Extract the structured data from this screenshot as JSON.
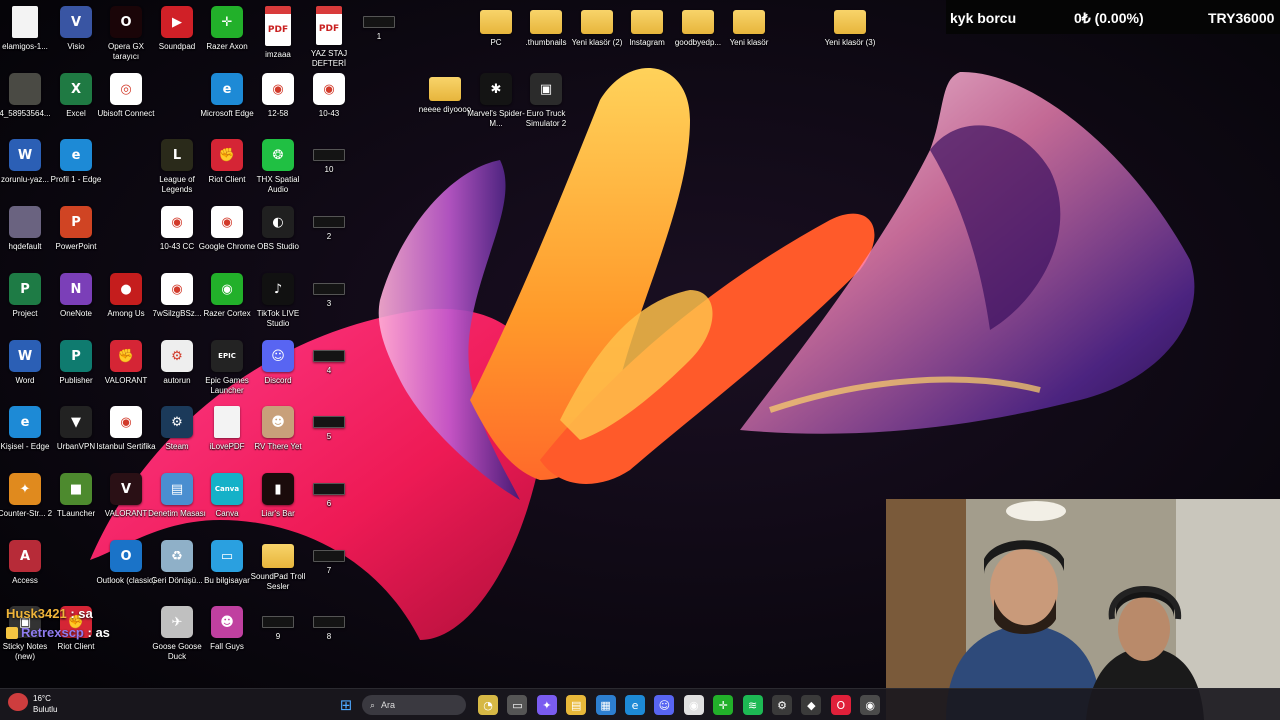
{
  "desktop_icons": [
    {
      "label": "elamigos-1...",
      "icon": "file-icon",
      "color": "#f3f3f3",
      "kind": "doc",
      "glyph": ""
    },
    {
      "label": "Visio",
      "icon": "visio-icon",
      "color": "#3955a3",
      "glyph": "V"
    },
    {
      "label": "Opera GX tarayıcı",
      "icon": "opera-gx-icon",
      "color": "#1a0508",
      "glyph": "O"
    },
    {
      "label": "Soundpad",
      "icon": "soundpad-icon",
      "color": "#d02027",
      "glyph": "▶"
    },
    {
      "label": "Razer Axon",
      "icon": "razer-axon-icon",
      "color": "#22b02a",
      "glyph": "✛"
    },
    {
      "label": "imzaaa",
      "icon": "pdf-icon",
      "kind": "pdf",
      "glyph": "PDF"
    },
    {
      "label": "YAZ STAJ DEFTERİ",
      "icon": "pdf-icon",
      "kind": "pdf",
      "glyph": "PDF"
    },
    {
      "label": "1",
      "icon": "thumbnail-icon",
      "kind": "tiny",
      "glyph": ""
    },
    {
      "label": "PC",
      "icon": "folder-icon",
      "kind": "folder",
      "glyph": ""
    },
    {
      "label": ".thumbnails",
      "icon": "folder-icon",
      "kind": "folder",
      "glyph": ""
    },
    {
      "label": "Yeni klasör (2)",
      "icon": "folder-icon",
      "kind": "folder",
      "glyph": ""
    },
    {
      "label": "Instagram",
      "icon": "folder-icon",
      "kind": "folder",
      "glyph": ""
    },
    {
      "label": "goodbyedp...",
      "icon": "folder-icon",
      "kind": "folder",
      "glyph": ""
    },
    {
      "label": "Yeni klasör",
      "icon": "folder-icon",
      "kind": "folder",
      "glyph": ""
    },
    {
      "label": "Yeni klasör (3)",
      "icon": "folder-icon",
      "kind": "folder",
      "glyph": ""
    },
    {
      "label": "4_58953564...",
      "icon": "image-file-icon",
      "color": "#4a4a44",
      "glyph": ""
    },
    {
      "label": "Excel",
      "icon": "excel-icon",
      "color": "#1f7a43",
      "glyph": "X"
    },
    {
      "label": "Ubisoft Connect",
      "icon": "ubisoft-icon",
      "color": "#ffffff",
      "glyph": "◎"
    },
    {
      "label": "Microsoft Edge",
      "icon": "edge-icon",
      "color": "#1d8ad6",
      "glyph": "e"
    },
    {
      "label": "12-58",
      "icon": "chrome-icon",
      "color": "#ffffff",
      "glyph": "◉"
    },
    {
      "label": "10-43",
      "icon": "chrome-icon",
      "color": "#ffffff",
      "glyph": "◉"
    },
    {
      "label": "neeee diyoooo",
      "icon": "folder-icon",
      "kind": "folder",
      "glyph": ""
    },
    {
      "label": "Marvel's Spider-M...",
      "icon": "spiderman-icon",
      "color": "#141414",
      "glyph": "✱"
    },
    {
      "label": "Euro Truck Simulator 2",
      "icon": "euro-truck-icon",
      "color": "#2b2b2b",
      "glyph": "▣"
    },
    {
      "label": "zorunlu-yaz...",
      "icon": "word-icon",
      "color": "#2b5fb5",
      "glyph": "W"
    },
    {
      "label": "Profil 1 - Edge",
      "icon": "edge-icon",
      "color": "#1d8ad6",
      "glyph": "e"
    },
    {
      "label": "League of Legends",
      "icon": "league-icon",
      "color": "#2a2a1a",
      "glyph": "L"
    },
    {
      "label": "Riot Client",
      "icon": "riot-icon",
      "color": "#d52535",
      "glyph": "✊"
    },
    {
      "label": "THX Spatial Audio",
      "icon": "thx-icon",
      "color": "#20c043",
      "glyph": "❂"
    },
    {
      "label": "10",
      "icon": "thumbnail-icon",
      "kind": "tiny",
      "glyph": ""
    },
    {
      "label": "hqdefault",
      "icon": "image-file-icon",
      "color": "#6a6380",
      "glyph": ""
    },
    {
      "label": "PowerPoint",
      "icon": "powerpoint-icon",
      "color": "#d04423",
      "glyph": "P"
    },
    {
      "label": "10-43 CC",
      "icon": "chrome-icon",
      "color": "#ffffff",
      "glyph": "◉"
    },
    {
      "label": "Google Chrome",
      "icon": "chrome-icon",
      "color": "#ffffff",
      "glyph": "◉"
    },
    {
      "label": "OBS Studio",
      "icon": "obs-icon",
      "color": "#202020",
      "glyph": "◐"
    },
    {
      "label": "2",
      "icon": "thumbnail-icon",
      "kind": "tiny",
      "glyph": ""
    },
    {
      "label": "Project",
      "icon": "project-icon",
      "color": "#1e7b45",
      "glyph": "P"
    },
    {
      "label": "OneNote",
      "icon": "onenote-icon",
      "color": "#7b3fb8",
      "glyph": "N"
    },
    {
      "label": "Among Us",
      "icon": "among-us-icon",
      "color": "#c51d1d",
      "glyph": "●"
    },
    {
      "label": "7wSilzgBSz...",
      "icon": "chrome-icon",
      "color": "#ffffff",
      "glyph": "◉"
    },
    {
      "label": "Razer Cortex",
      "icon": "razer-cortex-icon",
      "color": "#22b02a",
      "glyph": "◉"
    },
    {
      "label": "TikTok LIVE Studio",
      "icon": "tiktok-icon",
      "color": "#111111",
      "glyph": "♪"
    },
    {
      "label": "3",
      "icon": "thumbnail-icon",
      "kind": "tiny",
      "glyph": ""
    },
    {
      "label": "Word",
      "icon": "word-icon",
      "color": "#2b5fb5",
      "glyph": "W"
    },
    {
      "label": "Publisher",
      "icon": "publisher-icon",
      "color": "#0f7b6f",
      "glyph": "P"
    },
    {
      "label": "VALORANT",
      "icon": "valorant-icon",
      "color": "#d52535",
      "glyph": "✊"
    },
    {
      "label": "autorun",
      "icon": "settings-file-icon",
      "color": "#eeeeee",
      "glyph": "⚙"
    },
    {
      "label": "Epic Games Launcher",
      "icon": "epic-games-icon",
      "color": "#232323",
      "glyph": "EPIC"
    },
    {
      "label": "Discord",
      "icon": "discord-icon",
      "color": "#5865f2",
      "glyph": "☺"
    },
    {
      "label": "4",
      "icon": "thumbnail-icon",
      "kind": "tiny",
      "glyph": ""
    },
    {
      "label": "Kişisel - Edge",
      "icon": "edge-icon",
      "color": "#1d8ad6",
      "glyph": "e"
    },
    {
      "label": "UrbanVPN",
      "icon": "urbanvpn-icon",
      "color": "#222222",
      "glyph": "▼"
    },
    {
      "label": "Istanbul Sertifika",
      "icon": "chrome-icon",
      "color": "#ffffff",
      "glyph": "◉"
    },
    {
      "label": "Steam",
      "icon": "steam-icon",
      "color": "#1b3a5a",
      "glyph": "⚙"
    },
    {
      "label": "iLovePDF",
      "icon": "pdf-file-icon",
      "color": "#ffffff",
      "kind": "doc",
      "glyph": ""
    },
    {
      "label": "RV There Yet",
      "icon": "rv-there-yet-icon",
      "color": "#c8a07a",
      "glyph": "☻"
    },
    {
      "label": "5",
      "icon": "thumbnail-icon",
      "kind": "tiny",
      "glyph": ""
    },
    {
      "label": "Counter-Str... 2",
      "icon": "counter-strike-icon",
      "color": "#e08a1e",
      "glyph": "✦"
    },
    {
      "label": "TLauncher",
      "icon": "tlauncher-icon",
      "color": "#4d8a2e",
      "glyph": "■"
    },
    {
      "label": "VALORANT",
      "icon": "valorant-icon",
      "color": "#2a1015",
      "glyph": "V"
    },
    {
      "label": "Denetim Masası",
      "icon": "control-panel-icon",
      "color": "#4a8ed0",
      "glyph": "▤"
    },
    {
      "label": "Canva",
      "icon": "canva-icon",
      "color": "#15b1c8",
      "glyph": "Canva"
    },
    {
      "label": "Liar's Bar",
      "icon": "liars-bar-icon",
      "color": "#1a0b0b",
      "glyph": "▮"
    },
    {
      "label": "6",
      "icon": "thumbnail-icon",
      "kind": "tiny",
      "glyph": ""
    },
    {
      "label": "Access",
      "icon": "access-icon",
      "color": "#b72b38",
      "glyph": "A"
    },
    {
      "label": "Outlook (classic)",
      "icon": "outlook-icon",
      "color": "#1a73c8",
      "glyph": "O"
    },
    {
      "label": "Geri Dönüşü...",
      "icon": "recycle-bin-icon",
      "color": "#8fb0c8",
      "glyph": "♻"
    },
    {
      "label": "Bu bilgisayar",
      "icon": "this-pc-icon",
      "color": "#2aa0e0",
      "glyph": "▭"
    },
    {
      "label": "SoundPad Troll Sesler",
      "icon": "folder-icon",
      "kind": "folder",
      "glyph": ""
    },
    {
      "label": "7",
      "icon": "thumbnail-icon",
      "kind": "tiny",
      "glyph": ""
    },
    {
      "label": "Sticky Notes (new)",
      "icon": "sticky-notes-icon",
      "color": "#333333",
      "glyph": "▣"
    },
    {
      "label": "Riot Client",
      "icon": "riot-icon",
      "color": "#d52535",
      "glyph": "✊"
    },
    {
      "label": "Goose Goose Duck",
      "icon": "goose-goose-duck-icon",
      "color": "#c0c0c0",
      "glyph": "✈"
    },
    {
      "label": "Fall Guys",
      "icon": "fall-guys-icon",
      "color": "#c040a0",
      "glyph": "☻"
    },
    {
      "label": "9",
      "icon": "thumbnail-icon",
      "kind": "tiny",
      "glyph": ""
    },
    {
      "label": "8",
      "icon": "thumbnail-icon",
      "kind": "tiny",
      "glyph": ""
    }
  ],
  "ticker": {
    "name": "kyk borcu",
    "change": "0₺ (0.00%)",
    "value": "TRY36000"
  },
  "chat": [
    {
      "user": "Husk3421",
      "sep": " : ",
      "message": "sa",
      "color": "#f0b53a"
    },
    {
      "user": "Retrexscp",
      "sep": " : ",
      "message": "as",
      "color": "#8f7cf0"
    }
  ],
  "taskbar": {
    "weather_temp": "16°C",
    "weather_desc": "Bulutlu",
    "search_placeholder": "Ara",
    "apps": [
      {
        "name": "widgets-icon",
        "color": "#d6b845",
        "glyph": "◔"
      },
      {
        "name": "task-view-icon",
        "color": "#555555",
        "glyph": "▭"
      },
      {
        "name": "copilot-icon",
        "color": "#7a5cf0",
        "glyph": "✦"
      },
      {
        "name": "file-explorer-icon",
        "color": "#e8b83a",
        "glyph": "▤"
      },
      {
        "name": "microsoft-store-icon",
        "color": "#2d7fd0",
        "glyph": "▦"
      },
      {
        "name": "edge-icon",
        "color": "#1d8ad6",
        "glyph": "e"
      },
      {
        "name": "discord-icon",
        "color": "#5865f2",
        "glyph": "☺"
      },
      {
        "name": "chrome-icon",
        "color": "#e0e0e0",
        "glyph": "◉"
      },
      {
        "name": "razer-icon",
        "color": "#22b02a",
        "glyph": "✛"
      },
      {
        "name": "spotify-icon",
        "color": "#1db954",
        "glyph": "≋"
      },
      {
        "name": "steam-icon",
        "color": "#3a3a3a",
        "glyph": "⚙"
      },
      {
        "name": "soundpad-icon",
        "color": "#3a3a3a",
        "glyph": "◆"
      },
      {
        "name": "opera-gx-icon",
        "color": "#e0203a",
        "glyph": "O"
      },
      {
        "name": "chrome-icon",
        "color": "#4a4a4a",
        "glyph": "◉"
      }
    ]
  }
}
